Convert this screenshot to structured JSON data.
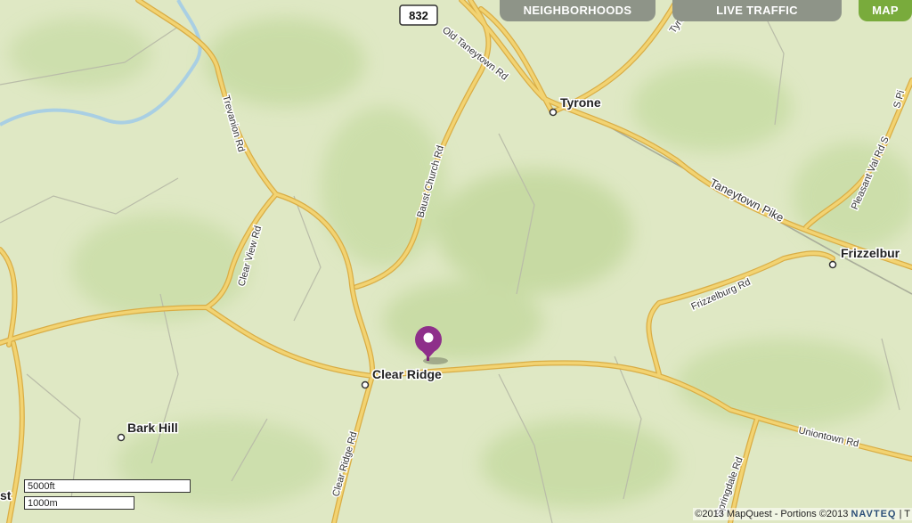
{
  "tabs": {
    "neighborhoods": "NEIGHBORHOODS",
    "live_traffic": "LIVE TRAFFIC",
    "map": "MAP"
  },
  "route_shield": "832",
  "places": {
    "tyrone": "Tyrone",
    "frizzelburg": "Frizzelbur",
    "clear_ridge": "Clear Ridge",
    "bark_hill": "Bark Hill",
    "edge_fragment": "st"
  },
  "roads": {
    "old_taneytown_rd": "Old Taneytown Rd",
    "tyrone_partial": "Tyrone",
    "s_pi_partial": "S Pi",
    "trevanion_rd": "Trevanion Rd",
    "baust_church_rd": "Baust Church Rd",
    "pleasant_val_rd": "Pleasant Val Rd S",
    "taneytown_pike": "Taneytown Pike",
    "clear_view_rd": "Clear View Rd",
    "frizzelburg_rd": "Frizzelburg Rd",
    "uniontown_rd": "Uniontown Rd",
    "clear_ridge_rd": "Clear Ridge Rd",
    "springdale_rd": "Springdale Rd"
  },
  "scale": {
    "imperial": "5000ft",
    "metric": "1000m"
  },
  "copyright": {
    "text": "©2013 MapQuest  -  Portions ©2013",
    "brand": "NAVTEQ",
    "tail": "| T"
  },
  "marker_icon": "location-pin-icon",
  "colors": {
    "land": "#dfe8c4",
    "road": "#f2d372",
    "road_casing": "#d9ad45",
    "water": "#a9cfe3",
    "pin": "#8e2f8a"
  }
}
